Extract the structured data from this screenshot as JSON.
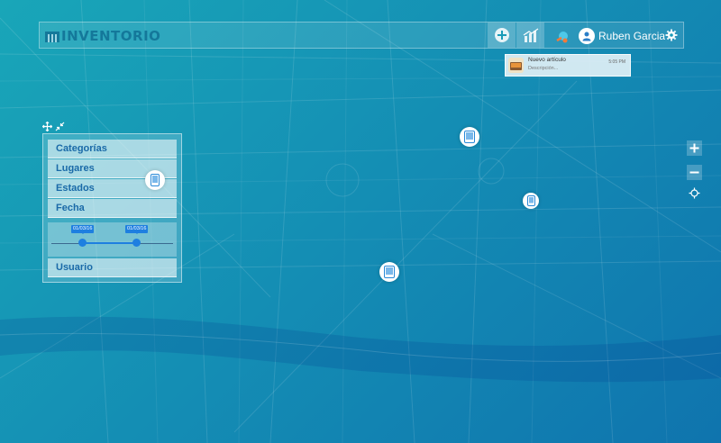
{
  "app": {
    "brand": "INVENTORIO"
  },
  "header": {
    "user": {
      "name": "Ruben Garcia"
    },
    "icons": [
      "building-icon",
      "add-circle-icon",
      "chart-icon",
      "notification-icon",
      "user-icon",
      "gear-icon"
    ]
  },
  "notification": {
    "title": "Nuevo artículo",
    "description": "Descripción...",
    "time": "5:05 PM"
  },
  "filters": {
    "items": [
      "Categorías",
      "Lugares",
      "Estados",
      "Fecha"
    ],
    "date_range": {
      "start": "01/03/16",
      "end": "01/03/16"
    },
    "user_label": "Usuario"
  },
  "map": {
    "markers": [
      "tablet-icon",
      "tablet-icon",
      "tablet-icon",
      "tablet-icon"
    ],
    "controls": [
      "zoom-in",
      "zoom-out",
      "locate"
    ]
  },
  "colors": {
    "brand": "#14789a",
    "accent": "#1e7fe0",
    "filter_text": "#1a6aa8",
    "background_start": "#19a6b8",
    "background_end": "#0f74ae"
  }
}
